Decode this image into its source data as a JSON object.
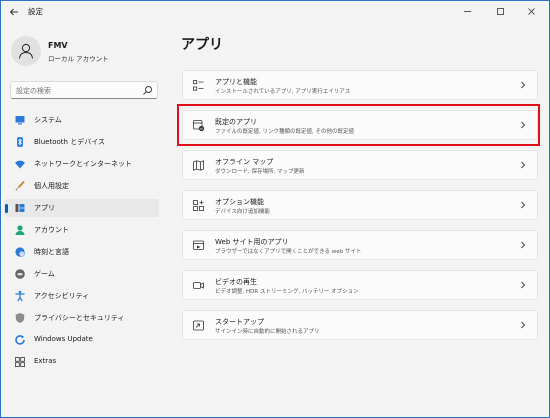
{
  "window": {
    "title": "設定"
  },
  "title_bar": {
    "minimize": "—",
    "maximize": "☐",
    "close": "✕"
  },
  "profile": {
    "name": "FMV",
    "account_type": "ローカル アカウント"
  },
  "search": {
    "placeholder": "設定の検索"
  },
  "sidebar": {
    "items": [
      {
        "label": "システム",
        "icon": "monitor-icon",
        "selected": false
      },
      {
        "label": "Bluetooth とデバイス",
        "icon": "bluetooth-icon",
        "selected": false
      },
      {
        "label": "ネットワークとインターネット",
        "icon": "wifi-icon",
        "selected": false
      },
      {
        "label": "個人用設定",
        "icon": "brush-icon",
        "selected": false
      },
      {
        "label": "アプリ",
        "icon": "apps-icon",
        "selected": true
      },
      {
        "label": "アカウント",
        "icon": "person-icon",
        "selected": false
      },
      {
        "label": "時刻と言語",
        "icon": "globe-clock-icon",
        "selected": false
      },
      {
        "label": "ゲーム",
        "icon": "gamepad-icon",
        "selected": false
      },
      {
        "label": "アクセシビリティ",
        "icon": "accessibility-icon",
        "selected": false
      },
      {
        "label": "プライバシーとセキュリティ",
        "icon": "shield-icon",
        "selected": false
      },
      {
        "label": "Windows Update",
        "icon": "update-icon",
        "selected": false
      },
      {
        "label": "Extras",
        "icon": "extras-icon",
        "selected": false
      }
    ]
  },
  "main": {
    "title": "アプリ",
    "cards": [
      {
        "title": "アプリと機能",
        "description": "インストールされているアプリ, アプリ実行エイリアス",
        "icon": "apps-list-icon",
        "highlighted": false
      },
      {
        "title": "既定のアプリ",
        "description": "ファイルの既定値, リンク種類の既定値, その他の既定値",
        "icon": "default-apps-icon",
        "highlighted": true
      },
      {
        "title": "オフライン マップ",
        "description": "ダウンロード, 保存場所, マップ更新",
        "icon": "map-icon",
        "highlighted": false
      },
      {
        "title": "オプション機能",
        "description": "デバイス向け追加機能",
        "icon": "optional-features-icon",
        "highlighted": false
      },
      {
        "title": "Web サイト用のアプリ",
        "description": "ブラウザーではなくアプリで開くことができる web サイト",
        "icon": "web-apps-icon",
        "highlighted": false
      },
      {
        "title": "ビデオの再生",
        "description": "ビデオ調整, HDR ストリーミング, バッテリー オプション",
        "icon": "video-icon",
        "highlighted": false
      },
      {
        "title": "スタートアップ",
        "description": "サインイン時に自動的に開始されるアプリ",
        "icon": "startup-icon",
        "highlighted": false
      }
    ]
  },
  "colors": {
    "accent": "#005fb8",
    "highlight": "#e0101a",
    "window_border": "#2c73c4"
  }
}
